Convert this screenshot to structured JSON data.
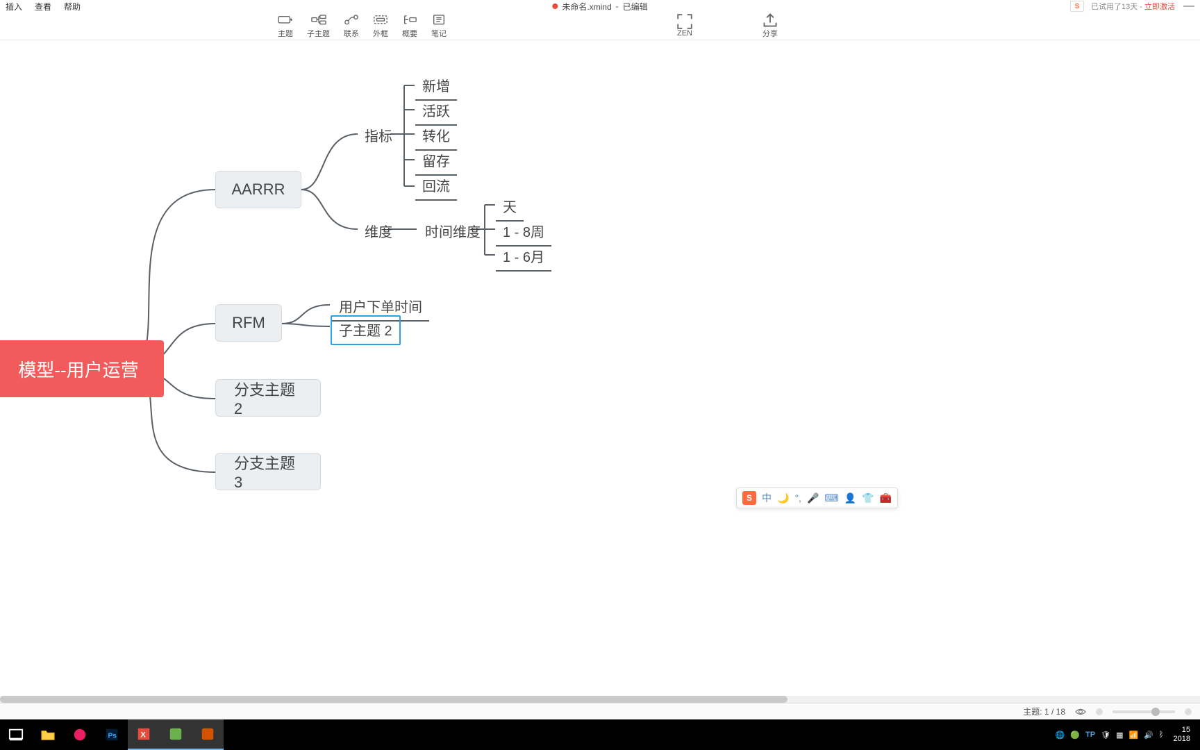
{
  "menu": {
    "insert": "插入",
    "view": "查看",
    "help": "帮助"
  },
  "title": {
    "filename": "未命名.xmind",
    "status": "已编辑"
  },
  "trial": {
    "prefix": "已试用了13天 - ",
    "action": "立即激活"
  },
  "toolbar": {
    "topic": "主题",
    "subtopic": "子主题",
    "relation": "联系",
    "boundary": "外框",
    "summary": "概要",
    "notes": "笔记",
    "zen": "ZEN",
    "share": "分享"
  },
  "mindmap": {
    "root": "模型--用户运营",
    "b1": {
      "label": "AARRR",
      "c1": {
        "label": "指标",
        "items": [
          "新增",
          "活跃",
          "转化",
          "留存",
          "回流"
        ]
      },
      "c2": {
        "label": "维度",
        "d1": {
          "label": "时间维度",
          "items": [
            "天",
            "1 - 8周",
            "1 - 6月"
          ]
        }
      }
    },
    "b2": {
      "label": "RFM",
      "c1": "用户下单时间",
      "c2": "子主题 2"
    },
    "b3": "分支主题 2",
    "b4": "分支主题 3"
  },
  "status": {
    "topic_label": "主题: ",
    "topic_count": "1 / 18"
  },
  "ime": {
    "lang": "中"
  },
  "taskbar": {
    "time": "15",
    "date": "2018"
  }
}
